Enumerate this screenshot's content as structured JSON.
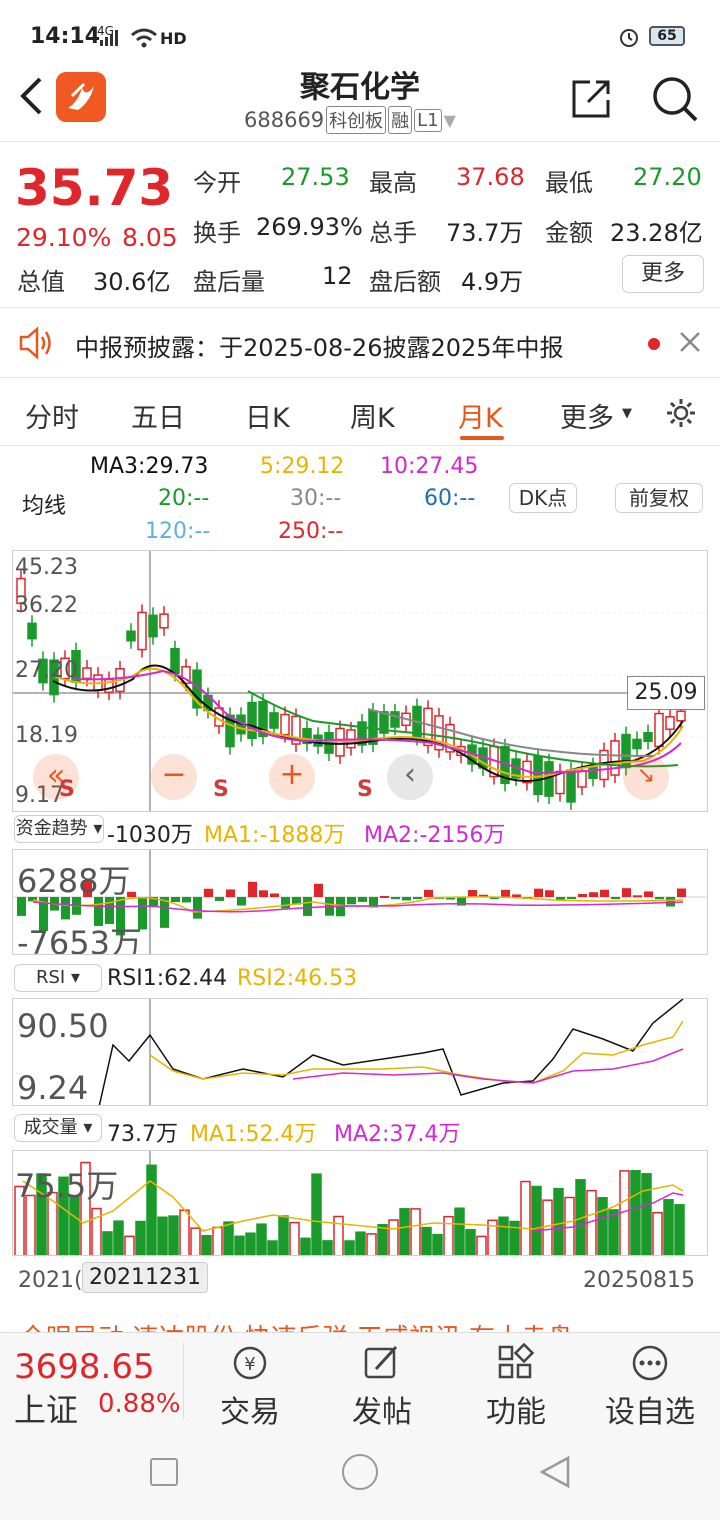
{
  "status": {
    "time": "14:14",
    "net": "4G",
    "hd": "HD",
    "battery": "65"
  },
  "header": {
    "title": "聚石化学",
    "code": "688669",
    "tag1": "科创板",
    "tag2": "融",
    "tag3": "L1"
  },
  "quote": {
    "price": "35.73",
    "change_pct": "29.10%",
    "change": "8.05",
    "open_label": "今开",
    "open": "27.53",
    "high_label": "最高",
    "high": "37.68",
    "low_label": "最低",
    "low": "27.20",
    "turnover_label": "换手",
    "turnover": "269.93%",
    "volume_label": "总手",
    "volume": "73.7万",
    "amount_label": "金额",
    "amount": "23.28亿",
    "mktcap_label": "总值",
    "mktcap": "30.6亿",
    "afterhours_vol_label": "盘后量",
    "afterhours_vol": "12",
    "afterhours_amt_label": "盘后额",
    "afterhours_amt": "4.9万",
    "more_label": "更多"
  },
  "notice": {
    "text": "中报预披露：于2025-08-26披露2025年中报"
  },
  "tabs": [
    "分时",
    "五日",
    "日K",
    "周K",
    "月K",
    "更多"
  ],
  "active_tab": "月K",
  "ma": {
    "label": "均线",
    "ma3": "MA3:29.73",
    "ma5": "5:29.12",
    "ma10": "10:27.45",
    "ma20": "20:--",
    "ma30": "30:--",
    "ma60": "60:--",
    "ma120": "120:--",
    "ma250": "250:--",
    "dk_label": "DK点",
    "adj_label": "前复权"
  },
  "kline": {
    "y_labels": [
      "45.23",
      "36.22",
      "27.20",
      "18.19",
      "9.17"
    ],
    "price_tag": "25.09",
    "signals": [
      "S",
      "S",
      "S"
    ]
  },
  "fund": {
    "selector": "资金趋势",
    "value": "-1030万",
    "ma1": "MA1:-1888万",
    "ma2": "MA2:-2156万",
    "y_top": "6288万",
    "y_bottom": "-7653万"
  },
  "rsi": {
    "selector": "RSI",
    "rsi1": "RSI1:62.44",
    "rsi2": "RSI2:46.53",
    "y_top": "90.50",
    "y_bottom": "9.24"
  },
  "vol": {
    "selector": "成交量",
    "value": "73.7万",
    "ma1": "MA1:52.4万",
    "ma2": "MA2:37.4万",
    "y_top": "75.5万"
  },
  "dates": {
    "start": "2021(",
    "cursor": "20211231",
    "end": "20250815"
  },
  "ticker": {
    "text": "全眼异动 速达股份 快速反弹 天威视讯 有大幸盘"
  },
  "index": {
    "value": "3698.65",
    "name": "上证",
    "pct": "0.88%"
  },
  "bottom_buttons": [
    "交易",
    "发帖",
    "功能",
    "设自选"
  ],
  "colors": {
    "up": "#e0262a",
    "down": "#1a9a2a",
    "accent": "#e8581e",
    "ma3": "#111111",
    "ma5": "#e8b400",
    "ma10": "#d12ad1",
    "ma20": "#1a9a2a",
    "ma30": "#888888",
    "ma60": "#1f6fb5",
    "ma120": "#5fb0e0",
    "ma250": "#e0262a"
  }
}
